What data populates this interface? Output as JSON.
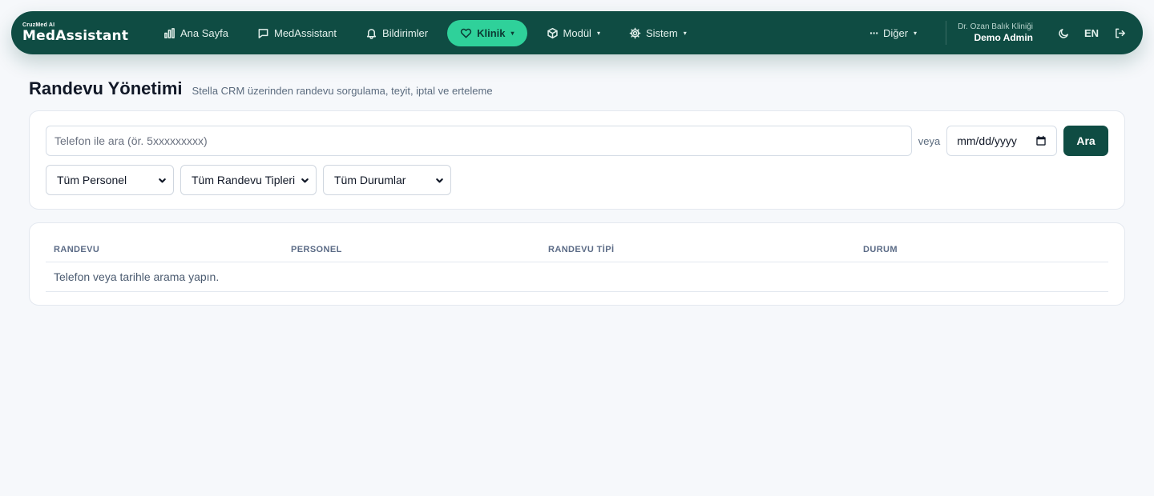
{
  "brand": {
    "sub": "CruzMed AI",
    "name": "MedAssistant"
  },
  "nav": {
    "items": [
      {
        "label": "Ana Sayfa",
        "icon": "bar-chart-icon",
        "active": false,
        "dropdown": false
      },
      {
        "label": "MedAssistant",
        "icon": "chat-icon",
        "active": false,
        "dropdown": false
      },
      {
        "label": "Bildirimler",
        "icon": "bell-icon",
        "active": false,
        "dropdown": false
      },
      {
        "label": "Klinik",
        "icon": "heart-icon",
        "active": true,
        "dropdown": true
      },
      {
        "label": "Modül",
        "icon": "cube-icon",
        "active": false,
        "dropdown": true
      },
      {
        "label": "Sistem",
        "icon": "gear-icon",
        "active": false,
        "dropdown": true
      }
    ],
    "more_label": "Diğer",
    "caret": "▾"
  },
  "user": {
    "clinic": "Dr. Ozan Balık Kliniği",
    "name": "Demo Admin"
  },
  "header_actions": {
    "theme_icon": "moon-icon",
    "lang": "EN",
    "logout_icon": "logout-icon"
  },
  "page": {
    "title": "Randevu Yönetimi",
    "subtitle": "Stella CRM üzerinden randevu sorgulama, teyit, iptal ve erteleme"
  },
  "search": {
    "phone_placeholder": "Telefon ile ara (ör. 5xxxxxxxxx)",
    "or_label": "veya",
    "date_placeholder": "mm/dd/yyyy",
    "button_label": "Ara"
  },
  "filters": {
    "staff": "Tüm Personel",
    "type": "Tüm Randevu Tipleri",
    "status": "Tüm Durumlar"
  },
  "table": {
    "columns": [
      "RANDEVU",
      "PERSONEL",
      "RANDEVU TİPİ",
      "DURUM"
    ],
    "empty_message": "Telefon veya tarihle arama yapın."
  },
  "colors": {
    "nav_bg": "#0f4c43",
    "accent": "#2fd19a",
    "primary_button": "#0f4c43",
    "page_bg": "#f6f8fb"
  }
}
